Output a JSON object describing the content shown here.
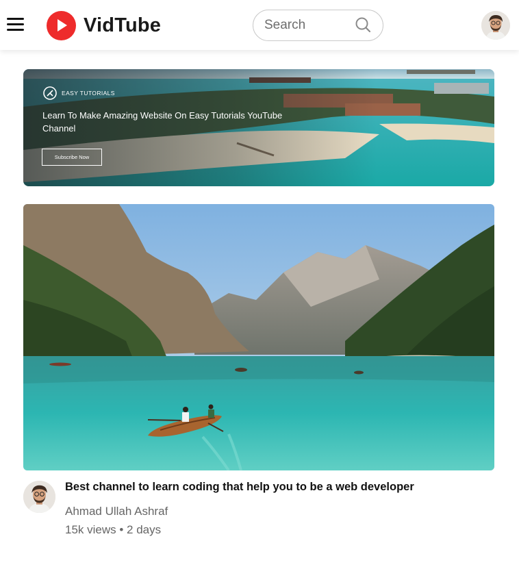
{
  "header": {
    "logo_text": "VidTube",
    "search_placeholder": "Search"
  },
  "banner": {
    "brand": "EASY TUTORIALS",
    "heading": "Learn To Make Amazing Website On Easy Tutorials YouTube Channel",
    "button_label": "Subscribe Now"
  },
  "video": {
    "title": "Best channel to learn coding that help you to be a web developer",
    "channel": "Ahmad Ullah Ashraf",
    "meta": "15k views • 2 days"
  },
  "icons": {
    "menu": "hamburger-menu-icon",
    "search": "magnifier-icon",
    "logo": "play-button-icon"
  },
  "colors": {
    "brand_red": "#ee2b2b",
    "water": "#2bb7b4"
  }
}
